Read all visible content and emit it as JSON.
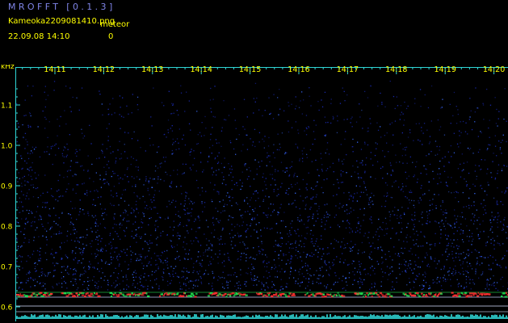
{
  "header": {
    "app_title": "MROFFT [0.1.3]",
    "filename": "Kameoka2209081410.png",
    "detection_label": "meteor",
    "datetime": "22.09.08  14:10",
    "detection_count": "0"
  },
  "axis": {
    "unit_label": "kHz",
    "freq_ticks": [
      "1.1",
      "1.0",
      "0.9",
      "0.8",
      "0.7",
      "0.6"
    ],
    "time_ticks": [
      "14:11",
      "14:12",
      "14:13",
      "14:14",
      "14:15",
      "14:16",
      "14:17",
      "14:18",
      "14:19",
      "14:20"
    ]
  },
  "colors": {
    "background": "#000000",
    "axis": "#2fd6d6",
    "ticks": "#ffff00",
    "title": "#7f84e6",
    "noise_low": "#1a2ab0",
    "noise_high": "#3a6cff",
    "carrier": "#ff3030",
    "carrier_halo": "#20e050"
  }
}
